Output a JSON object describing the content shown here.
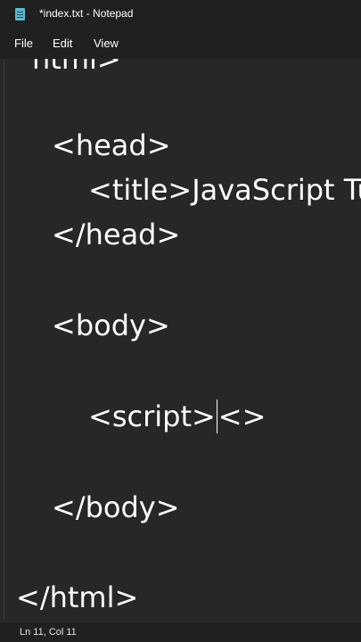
{
  "window": {
    "title": "*index.txt - Notepad"
  },
  "menu": {
    "file": "File",
    "edit": "Edit",
    "view": "View"
  },
  "editor": {
    "lines": [
      "html>",
      "<head>",
      "<title>JavaScript Tu",
      "</head>",
      "<body>",
      "<script>",
      "<>",
      "</body>",
      "</html>"
    ]
  },
  "status": {
    "position": "Ln 11, Col 11"
  },
  "colors": {
    "background": "#272727",
    "chrome": "#202020",
    "text": "#ffffff",
    "icon_accent": "#5fb6cf"
  },
  "icons": {
    "app": "notepad-icon"
  }
}
